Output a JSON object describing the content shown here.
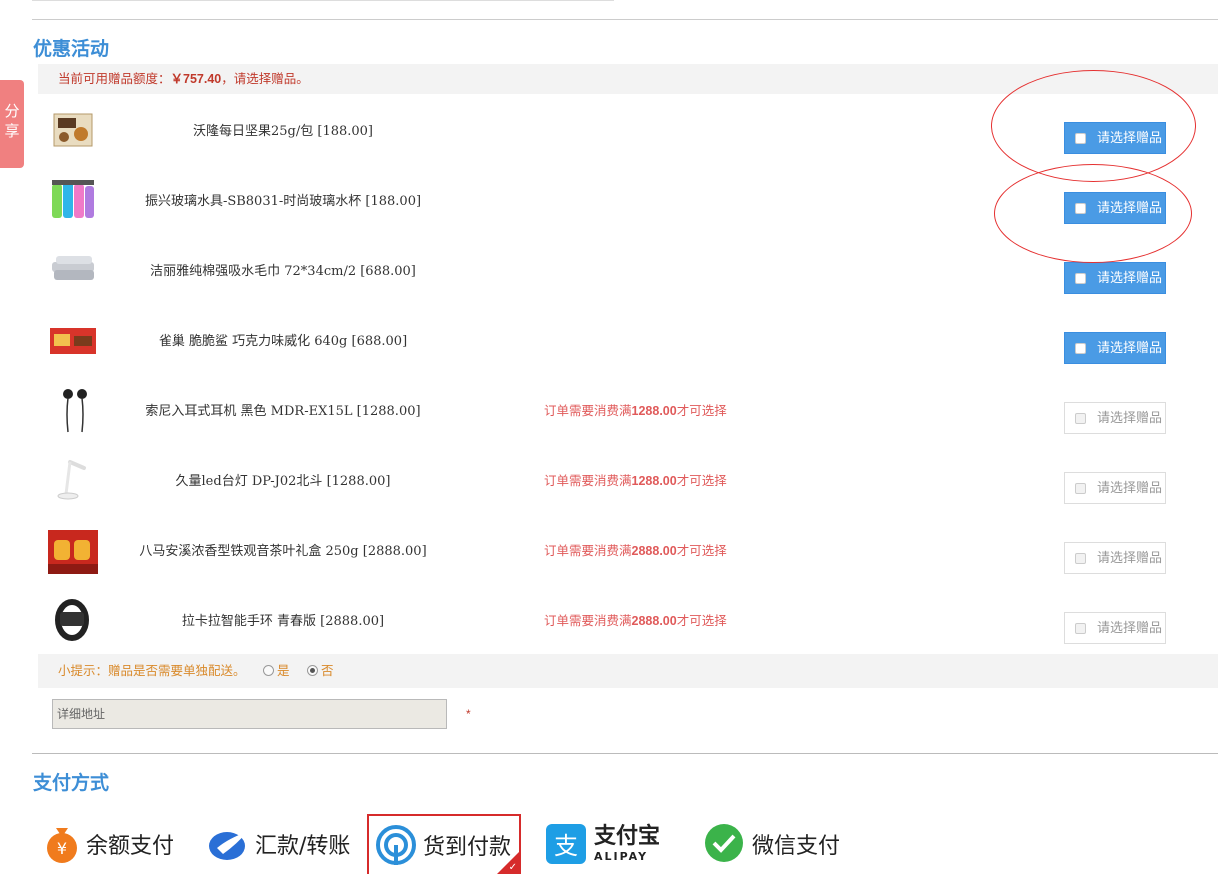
{
  "share_tab": {
    "chars": [
      "分",
      "享"
    ]
  },
  "promo": {
    "title": "优惠活动",
    "notice_prefix": "当前可用赠品额度：",
    "notice_amount": "￥757.40",
    "notice_suffix": "，请选择赠品。"
  },
  "gifts": [
    {
      "name": "沃隆每日坚果25g/包 ",
      "price": "[188.00]",
      "condition": "",
      "button": "请选择赠品",
      "enabled": true
    },
    {
      "name": "振兴玻璃水具-SB8031-时尚玻璃水杯 ",
      "price": "[188.00]",
      "condition": "",
      "button": "请选择赠品",
      "enabled": true
    },
    {
      "name": "洁丽雅纯棉强吸水毛巾 72*34cm/2 ",
      "price": "[688.00]",
      "condition": "",
      "button": "请选择赠品",
      "enabled": true
    },
    {
      "name": "雀巢 脆脆鲨 巧克力味威化 640g ",
      "price": "[688.00]",
      "condition": "",
      "button": "请选择赠品",
      "enabled": true
    },
    {
      "name": "索尼入耳式耳机 黑色 MDR-EX15L ",
      "price": "[1288.00]",
      "cond_prefix": "订单需要消费满",
      "cond_amount": "1288.00",
      "cond_suffix": "才可选择",
      "button": "请选择赠品",
      "enabled": false
    },
    {
      "name": "久量led台灯 DP-J02北斗 ",
      "price": "[1288.00]",
      "cond_prefix": "订单需要消费满",
      "cond_amount": "1288.00",
      "cond_suffix": "才可选择",
      "button": "请选择赠品",
      "enabled": false
    },
    {
      "name": "八马安溪浓香型铁观音茶叶礼盒 250g ",
      "price": "[2888.00]",
      "cond_prefix": "订单需要消费满",
      "cond_amount": "2888.00",
      "cond_suffix": "才可选择",
      "button": "请选择赠品",
      "enabled": false
    },
    {
      "name": "拉卡拉智能手环 青春版 ",
      "price": "[2888.00]",
      "cond_prefix": "订单需要消费满",
      "cond_amount": "2888.00",
      "cond_suffix": "才可选择",
      "button": "请选择赠品",
      "enabled": false
    }
  ],
  "tip": {
    "text": "小提示：赠品是否需要单独配送。",
    "yes_label": "是",
    "no_label": "否",
    "selected": "否"
  },
  "address": {
    "placeholder": "详细地址",
    "required_mark": "*"
  },
  "payment": {
    "title": "支付方式",
    "options": [
      {
        "label": "余额支付",
        "icon": "balance-wallet-icon"
      },
      {
        "label": "汇款/转账",
        "icon": "bank-transfer-icon"
      },
      {
        "label": "货到付款",
        "icon": "cash-on-delivery-icon",
        "selected": true
      },
      {
        "label": "支付宝",
        "sublabel": "ALIPAY",
        "icon": "alipay-icon"
      },
      {
        "label": "微信支付",
        "icon": "wechat-pay-icon"
      }
    ]
  },
  "colors": {
    "accent_blue": "#3d8ed6",
    "button_blue": "#4a9be5",
    "warning_red": "#e05a5a",
    "tip_orange": "#d98a2b",
    "selected_border": "#d62b2b"
  }
}
